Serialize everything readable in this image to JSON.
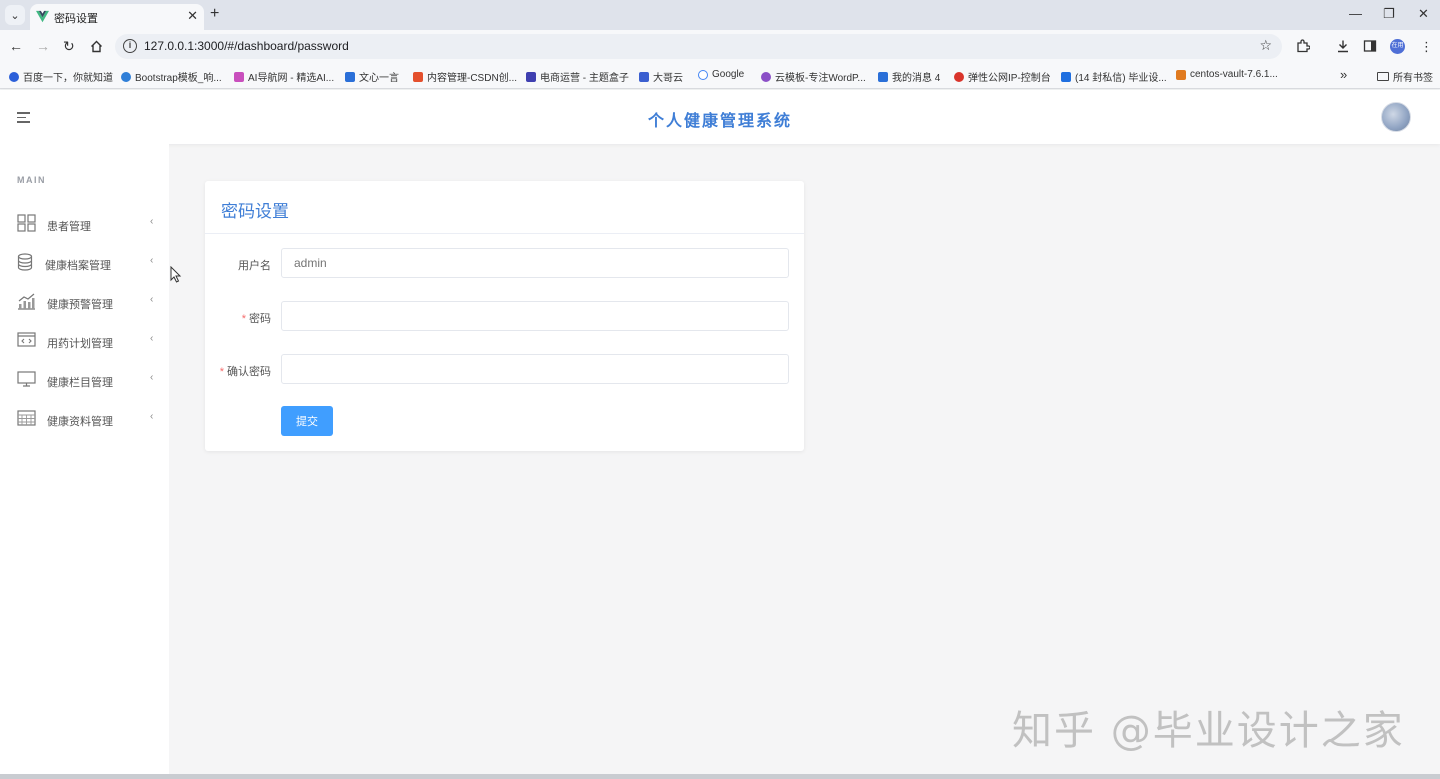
{
  "browser": {
    "tab_title": "密码设置",
    "tab_close": "✕",
    "new_tab": "+",
    "url": "127.0.0.1:3000/#/dashboard/password",
    "window_controls": [
      "—",
      "❐",
      "✕"
    ],
    "bookmarks": [
      {
        "label": "百度一下，你就知道",
        "color": "#2b5fd9"
      },
      {
        "label": "Bootstrap模板_响...",
        "color": "#2f7fd8"
      },
      {
        "label": "AI导航网 - 精选AI...",
        "color": "#c94fbd"
      },
      {
        "label": "文心一言",
        "color": "#2a6fd8"
      },
      {
        "label": "内容管理-CSDN创...",
        "color": "#e4502d"
      },
      {
        "label": "电商运营 - 主题盒子",
        "color": "#3f3fb0"
      },
      {
        "label": "大哥云",
        "color": "#3b5fd0"
      },
      {
        "label": "Google",
        "color": "#4285f4"
      },
      {
        "label": "云模板-专注WordP...",
        "color": "#8b4fc7"
      },
      {
        "label": "我的消息 4",
        "color": "#2a6fd8"
      },
      {
        "label": "弹性公网IP-控制台",
        "color": "#d9342b"
      },
      {
        "label": "(14 封私信) 毕业设...",
        "color": "#1f6fe0"
      },
      {
        "label": "centos-vault-7.6.1...",
        "color": "#e07a1f"
      }
    ],
    "bookmarks_folder": "所有书签",
    "profile_initials": "在用"
  },
  "app": {
    "title": "个人健康管理系统",
    "sidebar": {
      "section": "MAIN",
      "items": [
        {
          "label": "患者管理",
          "icon": "grid-icon"
        },
        {
          "label": "健康档案管理",
          "icon": "database-icon"
        },
        {
          "label": "健康预警管理",
          "icon": "chart-icon"
        },
        {
          "label": "用药计划管理",
          "icon": "code-window-icon"
        },
        {
          "label": "健康栏目管理",
          "icon": "monitor-icon"
        },
        {
          "label": "健康资料管理",
          "icon": "calendar-icon"
        }
      ]
    },
    "form": {
      "title": "密码设置",
      "username_label": "用户名",
      "username_placeholder": "admin",
      "password_label": "密码",
      "confirm_label": "确认密码",
      "required_mark": "*",
      "submit_label": "提交"
    }
  },
  "watermark": "知乎 @毕业设计之家",
  "colors": {
    "accent": "#3f7ed6",
    "button": "#409eff",
    "required": "#f56c6c"
  }
}
